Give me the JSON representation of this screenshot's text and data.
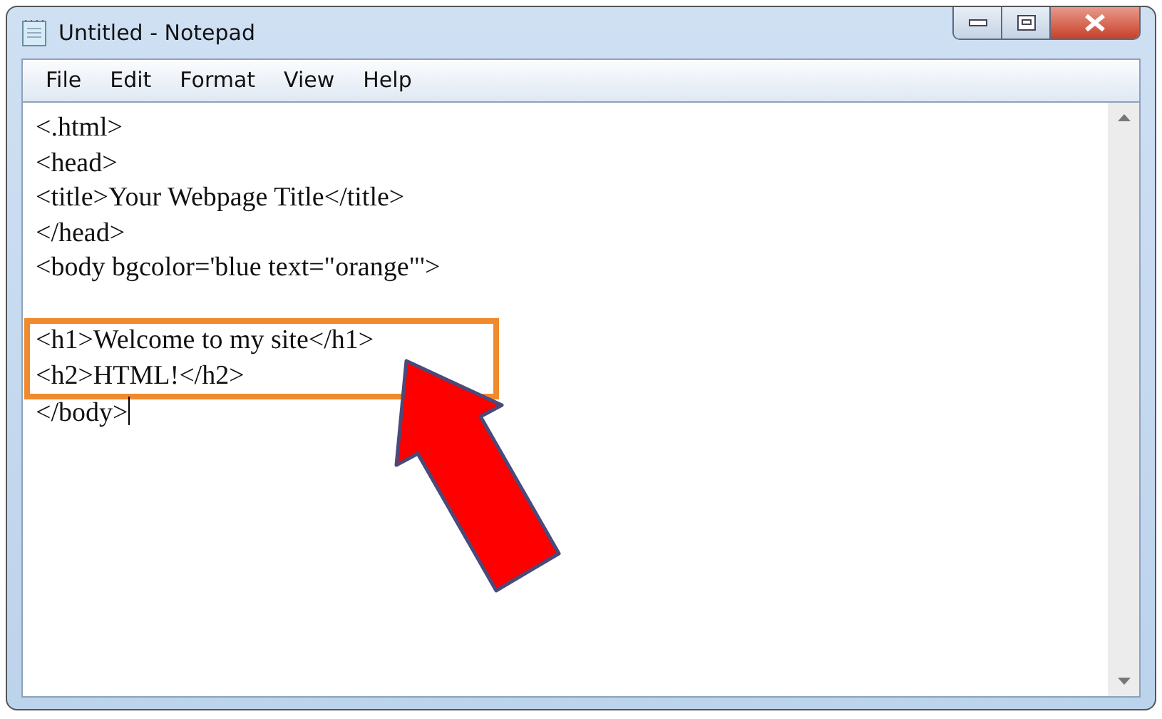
{
  "window": {
    "title": "Untitled - Notepad"
  },
  "menu": [
    "File",
    "Edit",
    "Format",
    "View",
    "Help"
  ],
  "editor": {
    "lines": [
      {
        "kind": "text",
        "text": "<.html>",
        "highlighted": false,
        "caret": false
      },
      {
        "kind": "text",
        "text": "<head>",
        "highlighted": false,
        "caret": false
      },
      {
        "kind": "text",
        "text": "<title>Your Webpage Title</title>",
        "highlighted": false,
        "caret": false
      },
      {
        "kind": "text",
        "text": "</head>",
        "highlighted": false,
        "caret": false
      },
      {
        "kind": "text",
        "text": "<body bgcolor='blue text=\"orange\"'>",
        "highlighted": false,
        "caret": false
      },
      {
        "kind": "blank"
      },
      {
        "kind": "text",
        "text": "<h1>Welcome to my site</h1>",
        "highlighted": true,
        "caret": false
      },
      {
        "kind": "text",
        "text": "<h2>HTML!</h2>",
        "highlighted": true,
        "caret": false
      },
      {
        "kind": "text",
        "text": "</body>",
        "highlighted": false,
        "caret": true
      }
    ]
  }
}
